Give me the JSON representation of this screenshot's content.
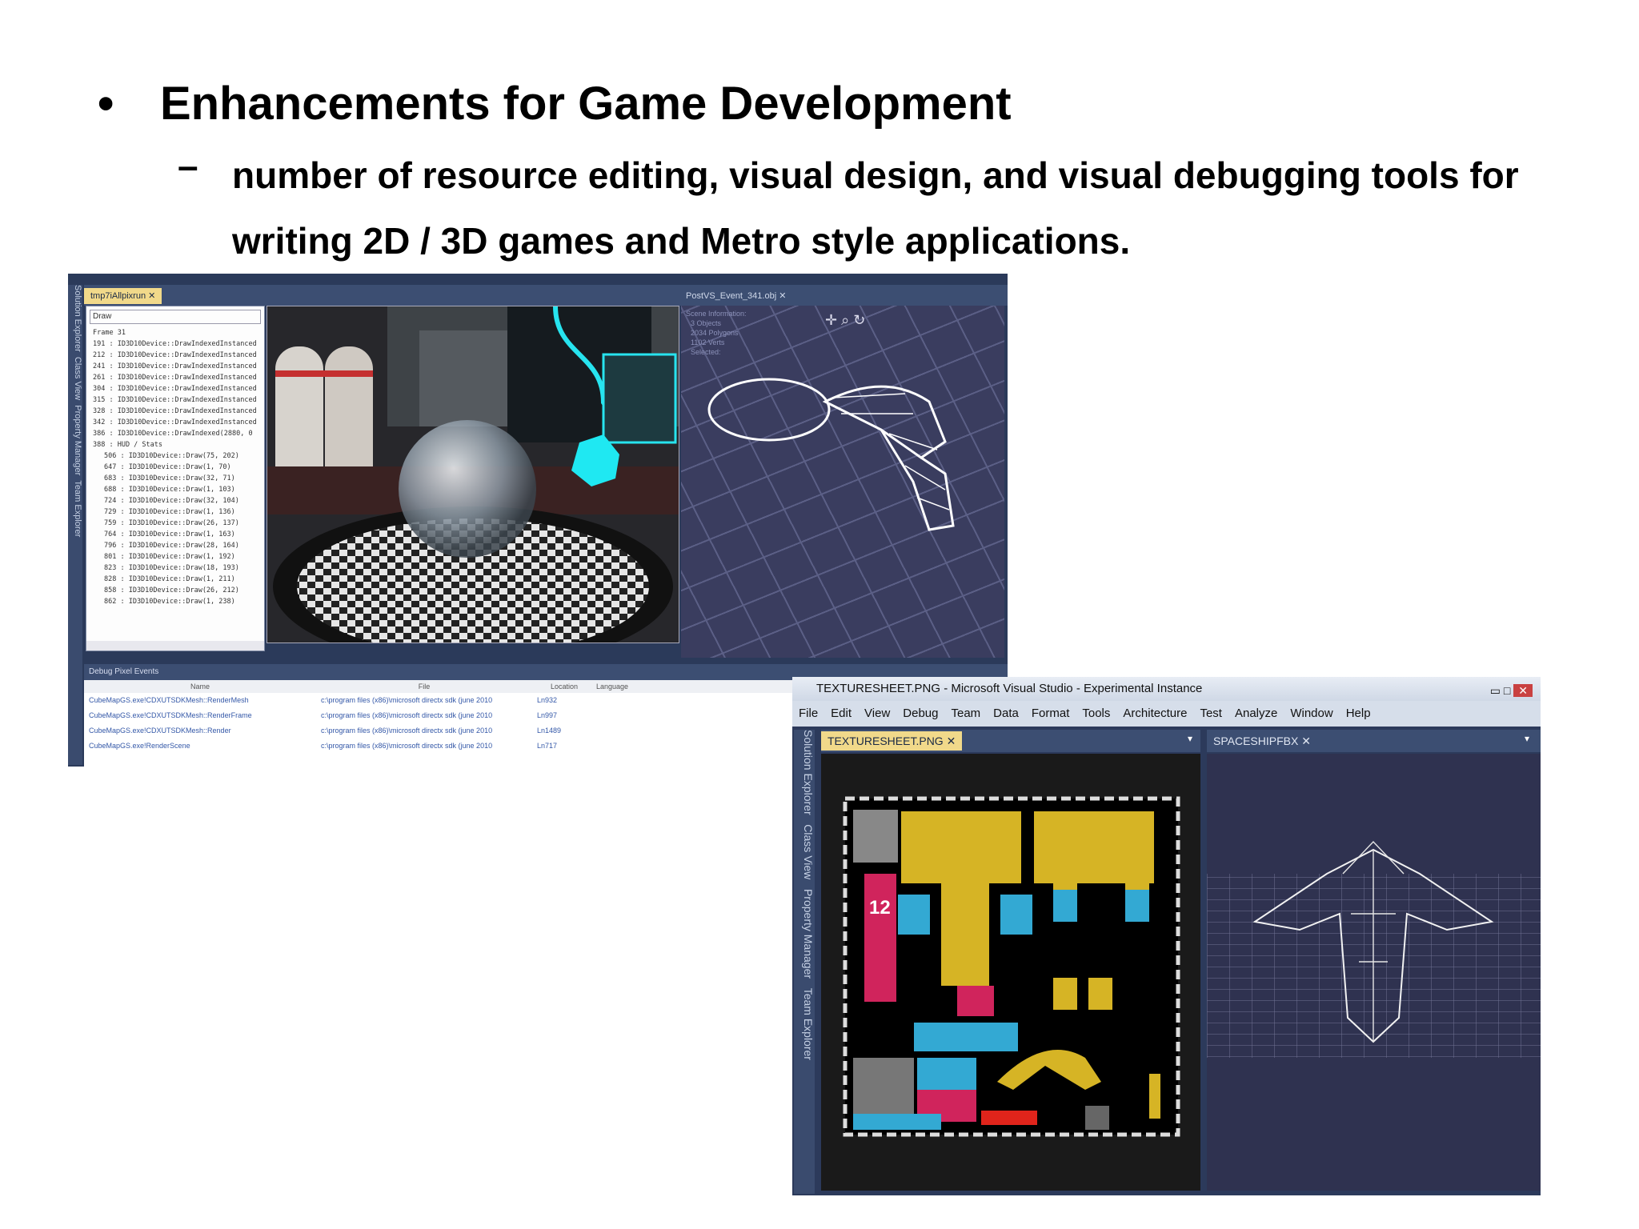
{
  "slide": {
    "bullet1_marker": "•",
    "bullet1_text": "Enhancements for Game Development",
    "bullet2_marker": "–",
    "bullet2_text": "number of resource editing, visual design, and visual debugging tools for writing 2D / 3D games and Metro style applications."
  },
  "screenshot1": {
    "left_tab": "tmp7iAllpixrun",
    "right_tab": "PostVS_Event_341.obj",
    "search_box": "Draw",
    "sidebar_labels": [
      "Solution Explorer",
      "Class View",
      "Property Manager",
      "Team Explorer"
    ],
    "events": [
      {
        "text": "Frame 31",
        "child": false
      },
      {
        "text": "191 : ID3D10Device::DrawIndexedInstanced",
        "child": false
      },
      {
        "text": "212 : ID3D10Device::DrawIndexedInstanced",
        "child": false
      },
      {
        "text": "241 : ID3D10Device::DrawIndexedInstanced",
        "child": false
      },
      {
        "text": "261 : ID3D10Device::DrawIndexedInstanced",
        "child": false
      },
      {
        "text": "304 : ID3D10Device::DrawIndexedInstanced",
        "child": false
      },
      {
        "text": "315 : ID3D10Device::DrawIndexedInstanced",
        "child": false
      },
      {
        "text": "328 : ID3D10Device::DrawIndexedInstanced",
        "child": false
      },
      {
        "text": "342 : ID3D10Device::DrawIndexedInstanced",
        "child": false
      },
      {
        "text": "386 : ID3D10Device::DrawIndexed(2880, 0",
        "child": false
      },
      {
        "text": "388 : HUD / Stats",
        "child": false
      },
      {
        "text": "506 : ID3D10Device::Draw(75, 202)",
        "child": true
      },
      {
        "text": "647 : ID3D10Device::Draw(1, 70)",
        "child": true
      },
      {
        "text": "683 : ID3D10Device::Draw(32, 71)",
        "child": true
      },
      {
        "text": "688 : ID3D10Device::Draw(1, 103)",
        "child": true
      },
      {
        "text": "724 : ID3D10Device::Draw(32, 104)",
        "child": true
      },
      {
        "text": "729 : ID3D10Device::Draw(1, 136)",
        "child": true
      },
      {
        "text": "759 : ID3D10Device::Draw(26, 137)",
        "child": true
      },
      {
        "text": "764 : ID3D10Device::Draw(1, 163)",
        "child": true
      },
      {
        "text": "796 : ID3D10Device::Draw(28, 164)",
        "child": true
      },
      {
        "text": "801 : ID3D10Device::Draw(1, 192)",
        "child": true
      },
      {
        "text": "823 : ID3D10Device::Draw(18, 193)",
        "child": true
      },
      {
        "text": "828 : ID3D10Device::Draw(1, 211)",
        "child": true
      },
      {
        "text": "858 : ID3D10Device::Draw(26, 212)",
        "child": true
      },
      {
        "text": "862 : ID3D10Device::Draw(1, 238)",
        "child": true
      }
    ],
    "scene_info": [
      "Scene Information:",
      "3 Objects",
      "2034 Polygons",
      "1102 Verts",
      "Selected:"
    ],
    "debug_panel_title": "Debug Pixel Events",
    "debug_columns": [
      "Name",
      "File",
      "Location",
      "Language"
    ],
    "debug_rows": [
      {
        "name": "CubeMapGS.exe!CDXUTSDKMesh::RenderMesh",
        "file": "c:\\program files (x86)\\microsoft directx sdk (june 2010",
        "loc": "Ln932"
      },
      {
        "name": "CubeMapGS.exe!CDXUTSDKMesh::RenderFrame",
        "file": "c:\\program files (x86)\\microsoft directx sdk (june 2010",
        "loc": "Ln997"
      },
      {
        "name": "CubeMapGS.exe!CDXUTSDKMesh::Render",
        "file": "c:\\program files (x86)\\microsoft directx sdk (june 2010",
        "loc": "Ln1489"
      },
      {
        "name": "CubeMapGS.exe!RenderScene",
        "file": "c:\\program files (x86)\\microsoft directx sdk (june 2010",
        "loc": "Ln717"
      }
    ]
  },
  "screenshot2": {
    "window_title": "TEXTURESHEET.PNG - Microsoft Visual Studio - Experimental Instance",
    "menu": [
      "File",
      "Edit",
      "View",
      "Debug",
      "Team",
      "Data",
      "Format",
      "Tools",
      "Architecture",
      "Test",
      "Analyze",
      "Window",
      "Help"
    ],
    "tab_left": "TEXTURESHEET.PNG",
    "tab_right": "SPACESHIPFBX",
    "sidebar_labels": [
      "Solution Explorer",
      "Class View",
      "Property Manager",
      "Team Explorer"
    ],
    "texture_number": "12"
  },
  "colors": {
    "vs_blue": "#2b3a5a",
    "tab_gold": "#f1d98a",
    "texture_yellow": "#d6b425",
    "texture_cyan": "#33a9d3",
    "texture_magenta": "#d0245c"
  }
}
